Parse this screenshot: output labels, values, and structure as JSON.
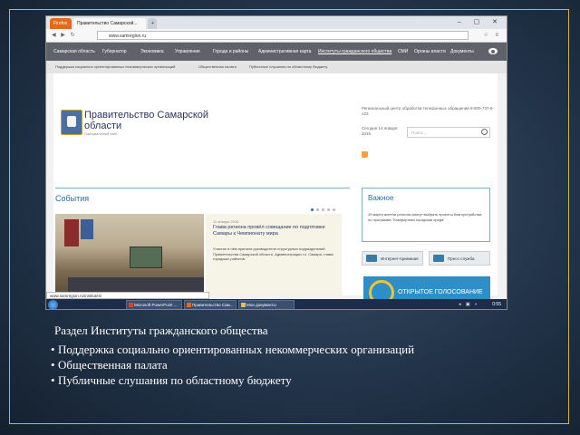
{
  "browser": {
    "menu_button": "Firefox",
    "active_tab": "Правительство Самарской...",
    "new_tab": "+",
    "url": "www.samregion.ru",
    "window_controls": "– ▢ ✕",
    "nav_glyphs": "◀ ▶ ↻",
    "tool_glyphs": "☆ ≡"
  },
  "site": {
    "nav": [
      "Самарская область",
      "Губернатор",
      "Экономика",
      "Управление",
      "Города и районы",
      "Административная карта",
      "Институты гражданского общества",
      "СМИ",
      "Органы власти",
      "Документы"
    ],
    "subnav": [
      "Поддержка социально ориентированных некоммерческих организаций",
      "Общественная палата",
      "Публичные слушания по областному бюджету"
    ],
    "brand_title": "Правительство Самарской области",
    "brand_subtitle": "Официальный сайт",
    "hotline": "Региональный центр обработки телефонных обращений 8-800-737-6-123",
    "date": "Сегодня 14 января 2016",
    "search_placeholder": "Поиск ...",
    "events_title": "События",
    "news_date": "11 января 2016",
    "news_headline": "Глава региона провёл совещание по подготовке Самары к Чемпионату мира",
    "news_text": "Участие в нём приняли руководители структурных подразделений Правительства Самарской области, Администрации г.о. Самара, главы городских районов.",
    "important_title": "Важное",
    "important_text": "19 марта жители региона смогут выбрать проекты благоустройства по программе \"Комфортная городская среда\"",
    "reception_button": "Интернет-приемная",
    "press_button": "Пресс-служба",
    "vote_banner": "ОТКРЫТОЕ ГОЛОСОВАНИЕ",
    "status_url": "www.samregion.ru/institutes/"
  },
  "taskbar": {
    "items": [
      "Microsoft PowerPoint ...",
      "Правительство Сам...",
      "Мои документы"
    ],
    "clock": "0:55"
  },
  "caption": {
    "title": "Раздел Институты гражданского общества",
    "items": [
      "Поддержка социально ориентированных некоммерческих организаций",
      "Общественная палата",
      "Публичные слушания по областному бюджету"
    ]
  },
  "colors": {
    "nav_bg": "#5f6268",
    "accent_blue": "#2a6ba8",
    "frame_gold": "#c9b84a",
    "background": "#22344a"
  }
}
